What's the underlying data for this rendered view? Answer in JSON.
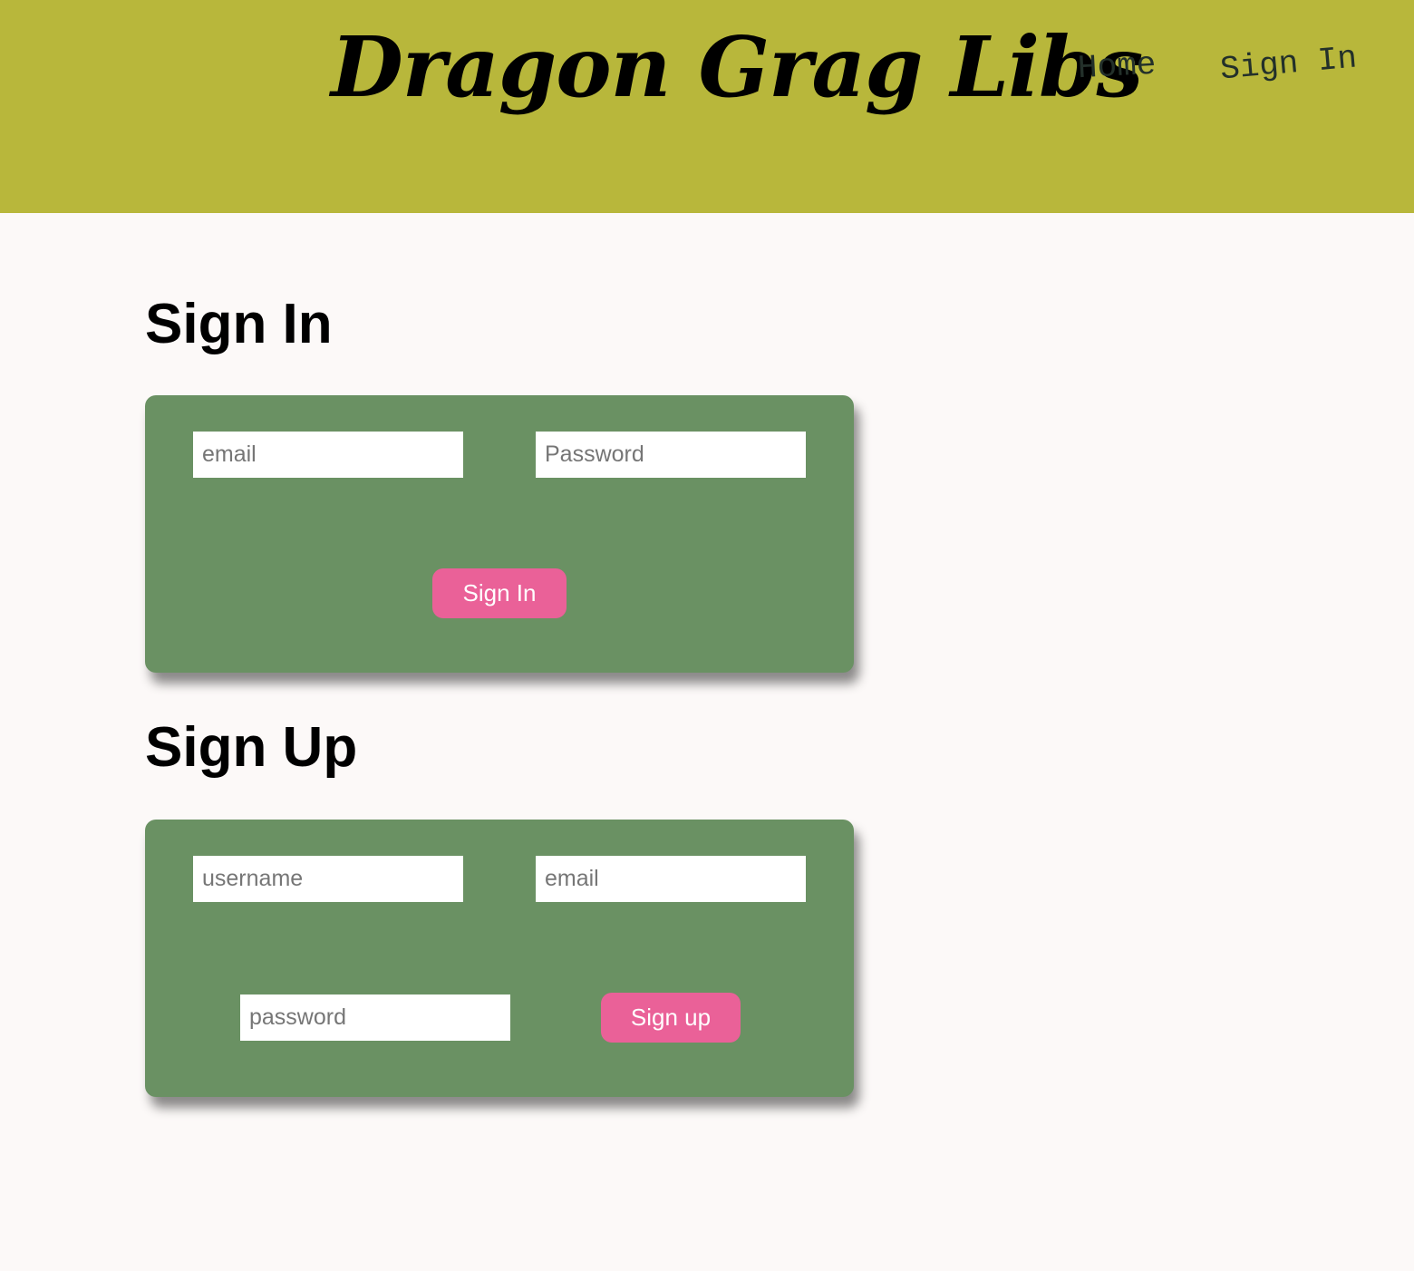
{
  "header": {
    "brand": "Dragon Grag Libs",
    "nav": [
      {
        "label": "Home"
      },
      {
        "label": "Sign In"
      }
    ]
  },
  "sign_in": {
    "title": "Sign In",
    "email": {
      "placeholder": "email",
      "value": ""
    },
    "password": {
      "placeholder": "Password",
      "value": ""
    },
    "submit_label": "Sign In"
  },
  "sign_up": {
    "title": "Sign Up",
    "username": {
      "placeholder": "username",
      "value": ""
    },
    "email": {
      "placeholder": "email",
      "value": ""
    },
    "password": {
      "placeholder": "password",
      "value": ""
    },
    "submit_label": "Sign up"
  },
  "colors": {
    "header_bg": "#b8b73b",
    "page_bg": "#fcf9f8",
    "card_bg": "#6a9163",
    "button_bg": "#ea6198"
  }
}
